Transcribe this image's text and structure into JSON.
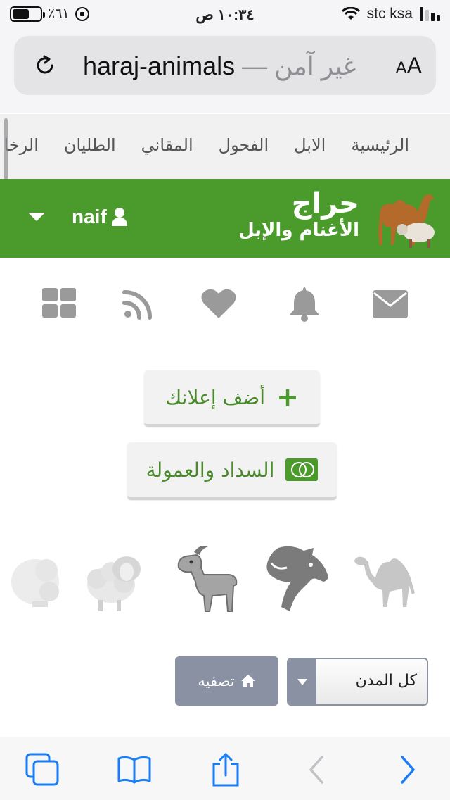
{
  "status_bar": {
    "battery_percent": "٪٦١",
    "battery_level": 0.61,
    "time": "١٠:٣٤ ص",
    "carrier": "stc ksa",
    "signal_bars": 2
  },
  "browser": {
    "url_host": "haraj-animals",
    "security_label": "غير آمن —",
    "text_size_label_small": "A",
    "text_size_label_large": "A"
  },
  "nav": {
    "items": [
      "الرئيسية",
      "الابل",
      "الفحول",
      "المقاني",
      "الطليان",
      "الرخا"
    ]
  },
  "header": {
    "logo_line1": "حراج",
    "logo_line2": "الأغنام والإبل",
    "username": "naif",
    "accent_color": "#4a9a2c"
  },
  "icons": [
    "envelope-icon",
    "bell-icon",
    "heart-icon",
    "rss-icon",
    "grid-icon"
  ],
  "actions": {
    "add_ad_label": "أضف إعلانك",
    "payment_label": "السداد والعمولة",
    "payment_icon_caption": "mastercard"
  },
  "animal_categories": [
    "camel-icon",
    "horse-icon",
    "goat-icon",
    "sheep-icon",
    "sheep-2-icon"
  ],
  "filter": {
    "city_value": "كل المدن",
    "filter_button_label": "تصفيه"
  }
}
